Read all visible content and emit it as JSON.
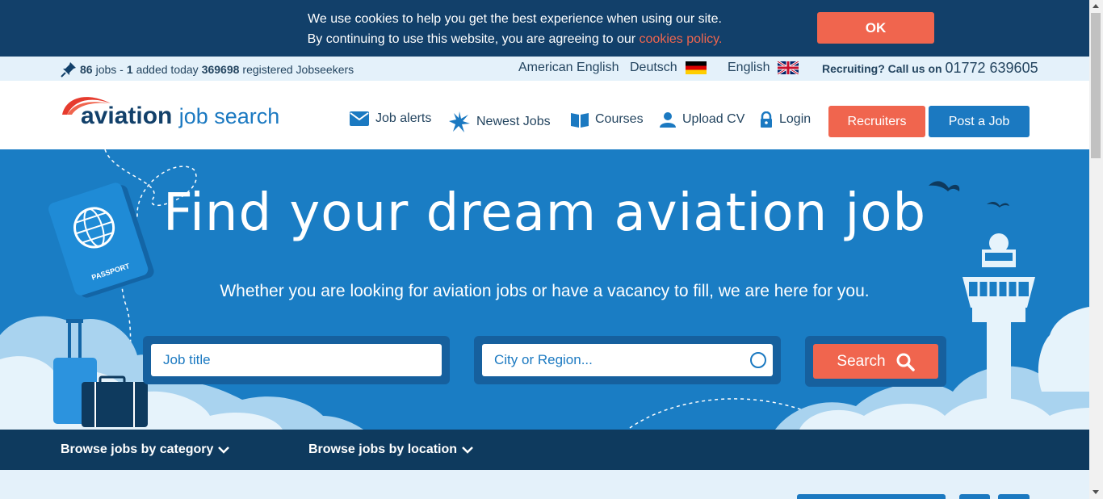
{
  "cookie": {
    "line1": "We use cookies to help you get the best experience when using our site.",
    "line2": "By continuing to use this website, you are agreeing to our",
    "link": "cookies policy.",
    "ok_label": "OK"
  },
  "info": {
    "jobs_count": "86",
    "jobs_label": "jobs -",
    "added_count": "1",
    "added_label": "added today",
    "seekers_count": "369698",
    "seekers_label": "registered Jobseekers",
    "lang_american": "American English",
    "lang_deutsch": "Deutsch",
    "lang_english": "English",
    "recruiting_label": "Recruiting? Call us on",
    "phone": "01772 639605"
  },
  "header": {
    "logo_bold": "aviation",
    "logo_light": "job search",
    "nav": {
      "job_alerts": "Job alerts",
      "newest_jobs": "Newest Jobs",
      "courses": "Courses",
      "upload_cv": "Upload CV",
      "login": "Login"
    },
    "recruiters": "Recruiters",
    "post_job": "Post a Job"
  },
  "hero": {
    "title": "Find your dream aviation job",
    "subtitle": "Whether you are looking for aviation jobs or have a vacancy to fill, we are here for you.",
    "job_placeholder": "Job title",
    "city_placeholder": "City or Region...",
    "search_label": "Search",
    "passport_label": "PASSPORT"
  },
  "browse": {
    "category": "Browse jobs by category",
    "location": "Browse jobs by location"
  },
  "colors": {
    "navy": "#12406a",
    "accent": "#f0654e",
    "blue": "#1b79c1",
    "hero": "#1a7dc4"
  }
}
